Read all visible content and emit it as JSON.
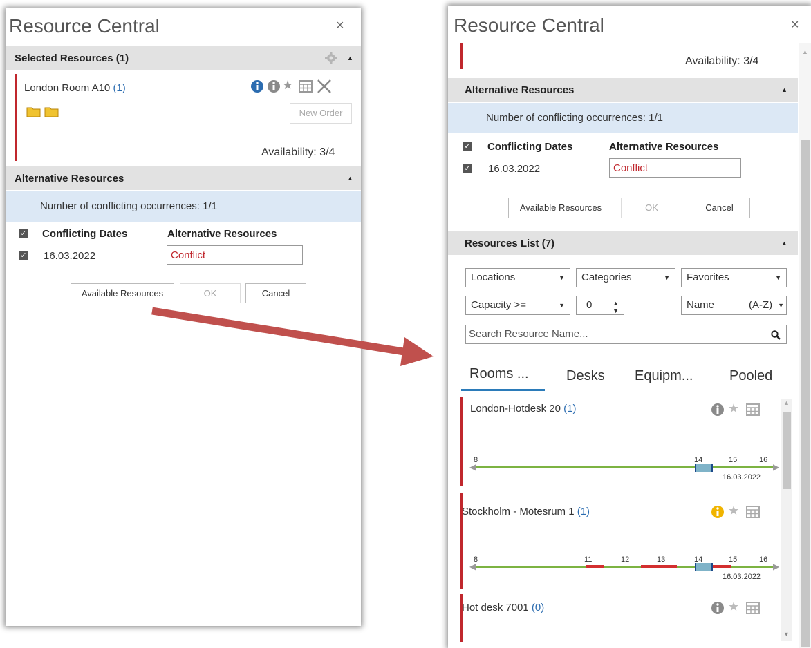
{
  "left": {
    "title": "Resource Central",
    "close": "×",
    "selected_header": "Selected Resources (1)",
    "resource_name": "London Room A10",
    "resource_count": "(1)",
    "new_order": "New Order",
    "availability": "Availability: 3/4",
    "alt_header": "Alternative Resources",
    "conflict_info": "Number of conflicting occurrences: 1/1",
    "col_dates": "Conflicting Dates",
    "col_alt": "Alternative Resources",
    "date": "16.03.2022",
    "conflict": "Conflict",
    "btn_available": "Available Resources",
    "btn_ok": "OK",
    "btn_cancel": "Cancel"
  },
  "right": {
    "title": "Resource Central",
    "close": "×",
    "availability": "Availability: 3/4",
    "alt_header": "Alternative Resources",
    "conflict_info": "Number of conflicting occurrences: 1/1",
    "col_dates": "Conflicting Dates",
    "col_alt": "Alternative Resources",
    "date": "16.03.2022",
    "conflict": "Conflict",
    "btn_available": "Available Resources",
    "btn_ok": "OK",
    "btn_cancel": "Cancel",
    "list_header": "Resources List (7)",
    "filters": {
      "locations": "Locations",
      "categories": "Categories",
      "favorites": "Favorites",
      "capacity": "Capacity >=",
      "capacity_value": "0",
      "sort_name": "Name",
      "sort_order": "(A-Z)",
      "search_placeholder": "Search Resource Name..."
    },
    "tabs": [
      "Rooms ...",
      "Desks",
      "Equipm...",
      "Pooled"
    ],
    "resources": [
      {
        "name": "London-Hotdesk 20",
        "count": "(1)",
        "ticks": [
          "8",
          "14",
          "15",
          "16"
        ],
        "date": "16.03.2022"
      },
      {
        "name": "Stockholm - Mötesrum 1",
        "count": "(1)",
        "ticks": [
          "8",
          "11",
          "12",
          "13",
          "14",
          "15",
          "16"
        ],
        "date": "16.03.2022"
      },
      {
        "name": "Hot desk 7001",
        "count": "(0)"
      }
    ]
  },
  "colors": {
    "accent_red": "#c0272d",
    "timeline_green": "#7cb342",
    "info_band": "#dce8f5"
  }
}
